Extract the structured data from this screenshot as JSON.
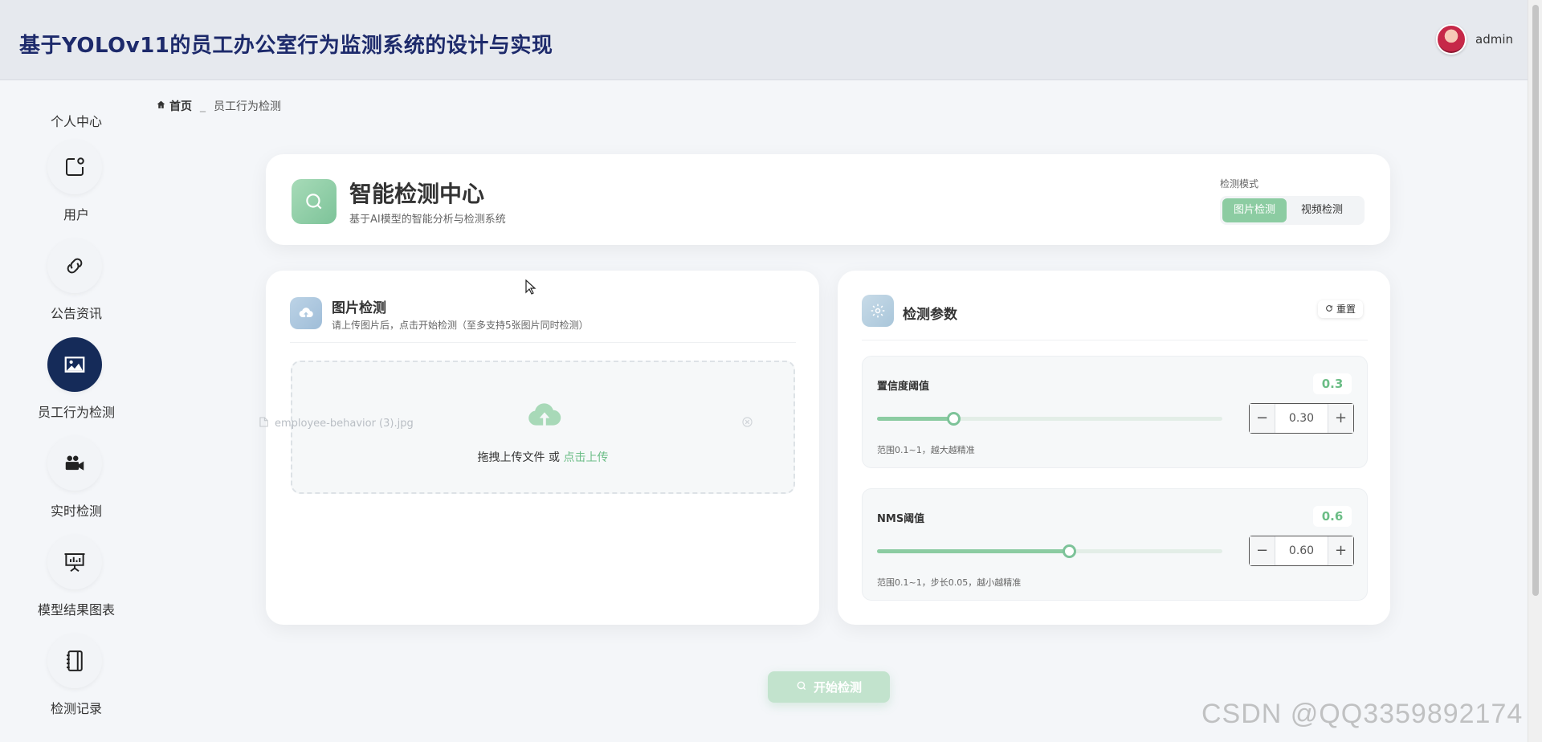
{
  "header": {
    "title": "基于YOLOv11的员工办公室行为监测系统的设计与实现",
    "username": "admin"
  },
  "sidebar": {
    "first_label": "个人中心",
    "items": [
      {
        "label": "用户",
        "icon": "user-box-icon"
      },
      {
        "label": "公告资讯",
        "icon": "link-icon"
      },
      {
        "label": "员工行为检测",
        "icon": "image-icon",
        "active": true
      },
      {
        "label": "实时检测",
        "icon": "video-camera-icon"
      },
      {
        "label": "模型结果图表",
        "icon": "presentation-chart-icon"
      },
      {
        "label": "检测记录",
        "icon": "notebook-icon"
      }
    ]
  },
  "breadcrumb": {
    "home": "首页",
    "separator": "_",
    "current": "员工行为检测"
  },
  "hero": {
    "title": "智能检测中心",
    "subtitle": "基于AI模型的智能分析与检测系统",
    "mode_label": "检测模式",
    "modes": [
      "图片检测",
      "视频检测"
    ]
  },
  "upload_panel": {
    "title": "图片检测",
    "subtitle": "请上传图片后，点击开始检测（至多支持5张图片同时检测）",
    "drop_text": "拖拽上传文件 或 ",
    "drop_link": "点击上传",
    "ghost_file": "employee-behavior (3).jpg"
  },
  "params_panel": {
    "title": "检测参数",
    "reset_label": "重置",
    "params": [
      {
        "name": "置信度阈值",
        "badge": "0.3",
        "value": "0.30",
        "fraction": 0.22,
        "hint": "范围0.1~1，越大越精准"
      },
      {
        "name": "NMS阈值",
        "badge": "0.6",
        "value": "0.60",
        "fraction": 0.555,
        "hint": "范围0.1~1，步长0.05，越小越精准"
      }
    ]
  },
  "start_button": "开始检测",
  "watermark": "CSDN @QQ3359892174",
  "colors": {
    "accent": "#8ccca2",
    "active_nav": "#152b59",
    "title": "#1d2a6b"
  }
}
